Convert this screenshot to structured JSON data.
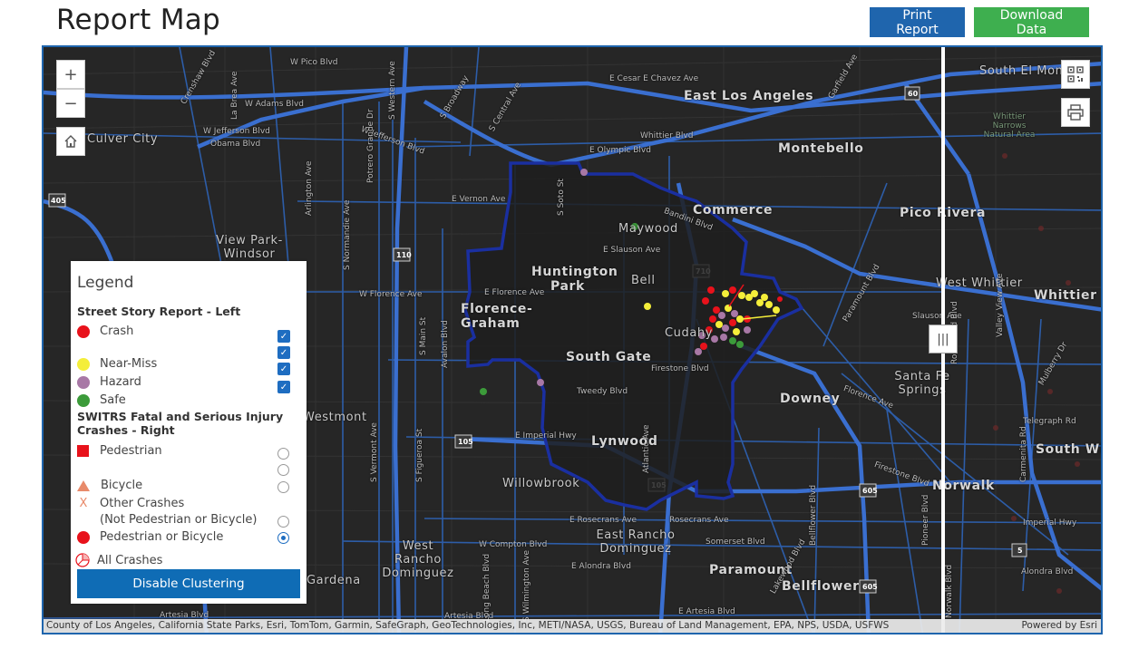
{
  "header": {
    "title": "Report Map"
  },
  "buttons": {
    "print": "Print Report",
    "download": "Download Data"
  },
  "map": {
    "controls": {
      "zoom_in": "+",
      "zoom_out": "−"
    },
    "swipe_handle": "|||",
    "cities": [
      {
        "label": "East Los Angeles",
        "cls": "city big"
      },
      {
        "label": "Montebello",
        "cls": "city big"
      },
      {
        "label": "Commerce",
        "cls": "city big"
      },
      {
        "label": "Pico Rivera",
        "cls": "city big"
      },
      {
        "label": "Maywood",
        "cls": "city"
      },
      {
        "label": "Bell",
        "cls": "city"
      },
      {
        "label": "Huntington Park",
        "cls": "city big"
      },
      {
        "label": "Florence-Graham",
        "cls": "city big"
      },
      {
        "label": "South Gate",
        "cls": "city big"
      },
      {
        "label": "Cudahy",
        "cls": "city"
      },
      {
        "label": "Lynwood",
        "cls": "city big"
      },
      {
        "label": "Downey",
        "cls": "city big"
      },
      {
        "label": "Willowbrook",
        "cls": "city"
      },
      {
        "label": "East Rancho Dominguez",
        "cls": "city"
      },
      {
        "label": "West Rancho Dominguez",
        "cls": "city"
      },
      {
        "label": "Paramount",
        "cls": "city big"
      },
      {
        "label": "Bellflower",
        "cls": "city big"
      },
      {
        "label": "Gardena",
        "cls": "city"
      },
      {
        "label": "Westmont",
        "cls": "city"
      },
      {
        "label": "View Park-Windsor Hills",
        "cls": "city"
      },
      {
        "label": "Culver City",
        "cls": "city"
      },
      {
        "label": "Santa Fe Springs",
        "cls": "city"
      },
      {
        "label": "Norwalk",
        "cls": "city big"
      },
      {
        "label": "West Whittier",
        "cls": "city"
      },
      {
        "label": "Whittier",
        "cls": "city big"
      },
      {
        "label": "South El Monte",
        "cls": "city"
      },
      {
        "label": "South Whittier",
        "cls": "city big"
      },
      {
        "label": "Whittier Narrows Natural Area",
        "cls": "street"
      }
    ],
    "streets": [
      "W Pico Blvd",
      "W Adams Blvd",
      "W Jefferson Blvd",
      "Obama Blvd",
      "W Jefferson Blvd",
      "E Olympic Blvd",
      "Whittier Blvd",
      "E Vernon Ave",
      "E Slauson Ave",
      "E Florence Ave",
      "W Florence Ave",
      "Firestone Blvd",
      "Tweedy Blvd",
      "E Imperial Hwy",
      "E Rosecrans Ave",
      "Rosecrans Ave",
      "W Compton Blvd",
      "Somerset Blvd",
      "E Alondra Blvd",
      "Artesia Blvd",
      "Artesia Blvd",
      "E Artesia Blvd",
      "Florence Ave",
      "Telegraph Rd",
      "Slauson Ave",
      "Imperial Hwy",
      "Alondra Blvd",
      "E Cesar E Chavez Ave",
      "Potrero Grande Dr",
      "S Vermont Ave",
      "S Figueroa St",
      "Avalon Blvd",
      "S Normandie Ave",
      "S Main St",
      "Atlantic Ave",
      "Lakewood Blvd",
      "Bellflower Blvd",
      "Paramount Blvd",
      "Pioneer Blvd",
      "Norwalk Blvd",
      "Crenshaw Blvd",
      "La Brea Ave",
      "S Western Ave",
      "Arlington Ave",
      "S Broadway",
      "S Central Ave",
      "S Soto St",
      "Rosemead Blvd",
      "Carmenita Rd",
      "Garfield Ave",
      "Bandini Blvd",
      "Mulberry Dr",
      "Firestone Blvd",
      "Long Beach Blvd",
      "S Wilmington Ave",
      "Valley View Ave"
    ],
    "highways": [
      "405",
      "110",
      "105",
      "105",
      "710",
      "605",
      "605",
      "5",
      "60"
    ],
    "attribution": "County of Los Angeles, California State Parks, Esri, TomTom, Garmin, SafeGraph, GeoTechnologies, Inc, METI/NASA, USGS, Bureau of Land Management, EPA, NPS, USDA, USFWS",
    "powered_by": "Powered by Esri"
  },
  "legend": {
    "title": "Legend",
    "group1_title": "Street Story Report - Left",
    "group1_items": [
      {
        "label": "Crash",
        "color": "#e8121b",
        "checked": true
      },
      {
        "label": "Near-Miss",
        "color": "#f4ee3a",
        "checked": true
      },
      {
        "label": "Hazard",
        "color": "#a878a6",
        "checked": true
      },
      {
        "label": "Safe",
        "color": "#3c9b3a",
        "checked": true
      }
    ],
    "group2_title": "SWITRS Fatal and Serious Injury Crashes - Right",
    "group2_items": [
      {
        "label": "Pedestrian",
        "symbol": "square",
        "color": "#e8121b"
      },
      {
        "label": "Bicycle",
        "symbol": "triangle",
        "color": "#e88a6a"
      },
      {
        "label": "Other Crashes",
        "sublabel": "(Not Pedestrian or Bicycle)",
        "symbol": "x",
        "color": "#e88a6a"
      },
      {
        "label": "Pedestrian or Bicycle",
        "symbol": "circle",
        "color": "#e8121b"
      },
      {
        "label": "All Crashes",
        "symbol": "pie",
        "color": "#e8121b"
      }
    ],
    "selected_radio": "Pedestrian or Bicycle",
    "button_label": "Disable Clustering"
  },
  "colors": {
    "accent": "#1f65ad",
    "download": "#3eaf4f",
    "highway": "#3a6fd0",
    "boundary": "#1a2fa0"
  }
}
